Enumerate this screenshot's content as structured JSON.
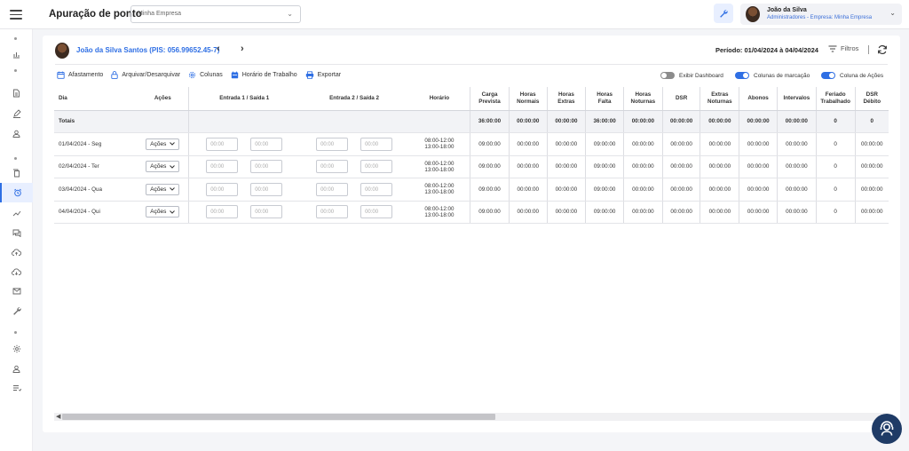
{
  "header": {
    "app_title": "Apuração de ponto",
    "company_select_value": "Minha Empresa",
    "user_name": "João da Silva",
    "user_role": "Administradores - Empresa: Minha Empresa"
  },
  "sidebar": {
    "items": [
      "chart-icon",
      "document-icon",
      "pen-icon",
      "user-icon",
      "copy-icon",
      "alarm-clock-icon",
      "trend-icon",
      "chat-icon",
      "cloud-up-icon",
      "cloud-down-icon",
      "mail-icon",
      "wrench-icon",
      "gear-icon",
      "person-icon",
      "list-icon"
    ],
    "active_item": "alarm-clock-icon"
  },
  "employee": {
    "label": "João da Silva Santos (PIS: 056.99652.45-7)",
    "prev": "‹",
    "next": "›"
  },
  "period": "Período: 01/04/2024 à 04/04/2024",
  "filters_label": "Filtros",
  "toolbar": {
    "afastamento": "Afastamento",
    "arquivar": "Arquivar/Desarquivar",
    "colunas": "Colunas",
    "horario_trabalho": "Horário de Trabalho",
    "exportar": "Exportar"
  },
  "toggles": {
    "dashboard": {
      "label": "Exibir Dashboard",
      "on": false
    },
    "marcacao": {
      "label": "Colunas de marcação",
      "on": true
    },
    "acoes": {
      "label": "Coluna de Ações",
      "on": true
    }
  },
  "table": {
    "headers": {
      "dia": "Dia",
      "acoes": "Ações",
      "entrada1": "Entrada 1 / Saída 1",
      "entrada2": "Entrada 2 / Saída 2",
      "horario": "Horário",
      "carga1": "Carga",
      "carga2": "Prevista",
      "normais1": "Horas",
      "normais2": "Normais",
      "extras1": "Horas",
      "extras2": "Extras",
      "falta1": "Horas",
      "falta2": "Falta",
      "noturnas1": "Horas",
      "noturnas2": "Noturnas",
      "dsr": "DSR",
      "extnot1": "Extras",
      "extnot2": "Noturnas",
      "abonos": "Abonos",
      "intervalos": "Intervalos",
      "feriado1": "Feriado",
      "feriado2": "Trabalhado",
      "dsrdeb1": "DSR",
      "dsrdeb2": "Débito"
    },
    "totals": {
      "label": "Totais",
      "carga": "36:00:00",
      "normais": "00:00:00",
      "extras": "00:00:00",
      "falta": "36:00:00",
      "noturnas": "00:00:00",
      "dsr": "00:00:00",
      "extnot": "00:00:00",
      "abonos": "00:00:00",
      "intervalos": "00:00:00",
      "feriado": "0",
      "dsrdeb": "0"
    },
    "action_label": "Ações",
    "time_placeholder": "00:00",
    "rows": [
      {
        "dia": "01/04/2024 - Seg",
        "h1": "08:00-12:00",
        "h2": "13:00-18:00",
        "carga": "09:00:00",
        "normais": "00:00:00",
        "extras": "00:00:00",
        "falta": "09:00:00",
        "noturnas": "00:00:00",
        "dsr": "00:00:00",
        "extnot": "00:00:00",
        "abonos": "00:00:00",
        "intervalos": "00:00:00",
        "feriado": "0",
        "dsrdeb": "00:00:00"
      },
      {
        "dia": "02/04/2024 - Ter",
        "h1": "08:00-12:00",
        "h2": "13:00-18:00",
        "carga": "09:00:00",
        "normais": "00:00:00",
        "extras": "00:00:00",
        "falta": "09:00:00",
        "noturnas": "00:00:00",
        "dsr": "00:00:00",
        "extnot": "00:00:00",
        "abonos": "00:00:00",
        "intervalos": "00:00:00",
        "feriado": "0",
        "dsrdeb": "00:00:00"
      },
      {
        "dia": "03/04/2024 - Qua",
        "h1": "08:00-12:00",
        "h2": "13:00-18:00",
        "carga": "09:00:00",
        "normais": "00:00:00",
        "extras": "00:00:00",
        "falta": "09:00:00",
        "noturnas": "00:00:00",
        "dsr": "00:00:00",
        "extnot": "00:00:00",
        "abonos": "00:00:00",
        "intervalos": "00:00:00",
        "feriado": "0",
        "dsrdeb": "00:00:00"
      },
      {
        "dia": "04/04/2024 - Qui",
        "h1": "08:00-12:00",
        "h2": "13:00-18:00",
        "carga": "09:00:00",
        "normais": "00:00:00",
        "extras": "00:00:00",
        "falta": "09:00:00",
        "noturnas": "00:00:00",
        "dsr": "00:00:00",
        "extnot": "00:00:00",
        "abonos": "00:00:00",
        "intervalos": "00:00:00",
        "feriado": "0",
        "dsrdeb": "00:00:00"
      }
    ]
  },
  "colors": {
    "accent": "#2f6fe4",
    "fab": "#1f3b66"
  }
}
